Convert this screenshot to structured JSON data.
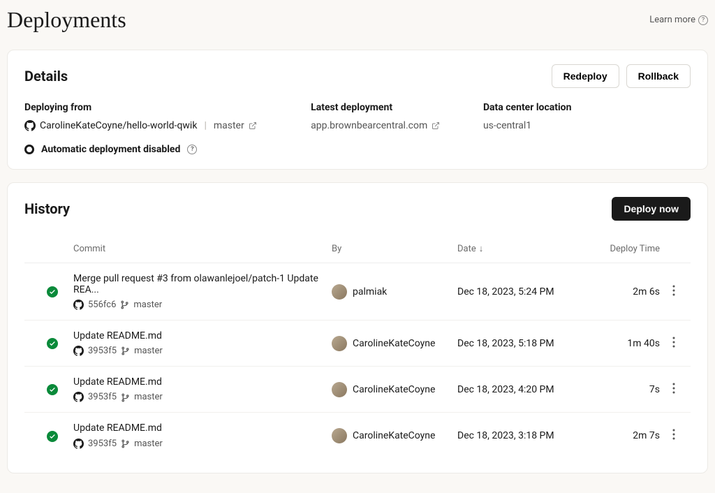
{
  "page": {
    "title": "Deployments",
    "learnMore": "Learn more"
  },
  "details": {
    "title": "Details",
    "buttons": {
      "redeploy": "Redeploy",
      "rollback": "Rollback"
    },
    "deployingFrom": {
      "label": "Deploying from",
      "repo": "CarolineKateCoyne/hello-world-qwik",
      "branch": "master"
    },
    "latestDeployment": {
      "label": "Latest deployment",
      "value": "app.brownbearcentral.com"
    },
    "dataCenter": {
      "label": "Data center location",
      "value": "us-central1"
    },
    "autoDeploy": "Automatic deployment disabled"
  },
  "history": {
    "title": "History",
    "deployNow": "Deploy now",
    "columns": {
      "commit": "Commit",
      "by": "By",
      "date": "Date",
      "deployTime": "Deploy Time"
    },
    "rows": [
      {
        "message": "Merge pull request #3 from olawanlejoel/patch-1 Update REA...",
        "hash": "556fc6",
        "branch": "master",
        "author": "palmiak",
        "date": "Dec 18, 2023, 5:24 PM",
        "deployTime": "2m 6s"
      },
      {
        "message": "Update README.md",
        "hash": "3953f5",
        "branch": "master",
        "author": "CarolineKateCoyne",
        "date": "Dec 18, 2023, 5:18 PM",
        "deployTime": "1m 40s"
      },
      {
        "message": "Update README.md",
        "hash": "3953f5",
        "branch": "master",
        "author": "CarolineKateCoyne",
        "date": "Dec 18, 2023, 4:20 PM",
        "deployTime": "7s"
      },
      {
        "message": "Update README.md",
        "hash": "3953f5",
        "branch": "master",
        "author": "CarolineKateCoyne",
        "date": "Dec 18, 2023, 3:18 PM",
        "deployTime": "2m 7s"
      }
    ]
  }
}
